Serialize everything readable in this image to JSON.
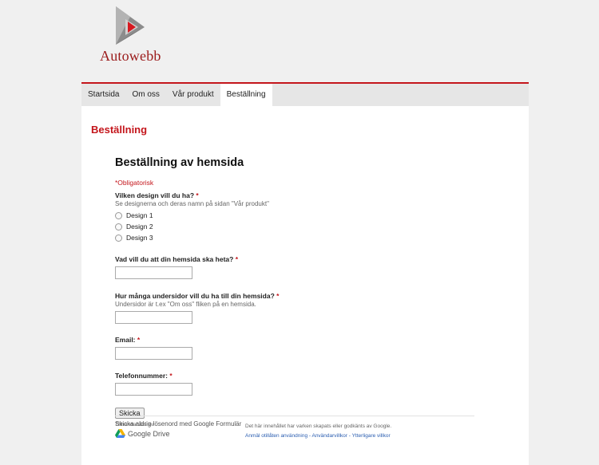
{
  "brand": {
    "name": "Autowebb"
  },
  "nav": {
    "items": [
      {
        "label": "Startsida"
      },
      {
        "label": "Om oss"
      },
      {
        "label": "Vår produkt"
      },
      {
        "label": "Beställning",
        "active": true
      }
    ]
  },
  "page": {
    "heading": "Beställning"
  },
  "form": {
    "title": "Beställning av hemsida",
    "required_note": "*Obligatorisk",
    "q1": {
      "label": "Vilken design vill du ha?",
      "help": "Se designerna och deras namn på sidan \"Vår produkt\"",
      "options": [
        "Design 1",
        "Design 2",
        "Design 3"
      ]
    },
    "q2": {
      "label": "Vad vill du att din hemsida ska heta?",
      "value": ""
    },
    "q3": {
      "label": "Hur många undersidor vill du ha till din hemsida?",
      "help": "Undersidor är t.ex \"Om oss\" fliken på en hemsida.",
      "value": ""
    },
    "q4": {
      "label": "Email:",
      "value": ""
    },
    "q5": {
      "label": "Telefonnummer:",
      "value": ""
    },
    "required_star": "*",
    "submit_label": "Skicka",
    "password_note": "Skicka aldrig lösenord med Google Formulär"
  },
  "footer": {
    "powered_by": "Tillhandahålls av",
    "drive_label": "Google Drive",
    "disclaimer": "Det här innehållet har varken skapats eller godkänts av Google.",
    "links": [
      {
        "label": "Anmäl otillåten användning"
      },
      {
        "label": "Användarvillkor"
      },
      {
        "label": "Ytterligare villkor"
      }
    ],
    "separator": " - "
  },
  "colors": {
    "accent": "#c4161c",
    "link": "#2a5db0",
    "nav_bg": "#e6e6e6",
    "page_bg": "#f0f0f0"
  }
}
